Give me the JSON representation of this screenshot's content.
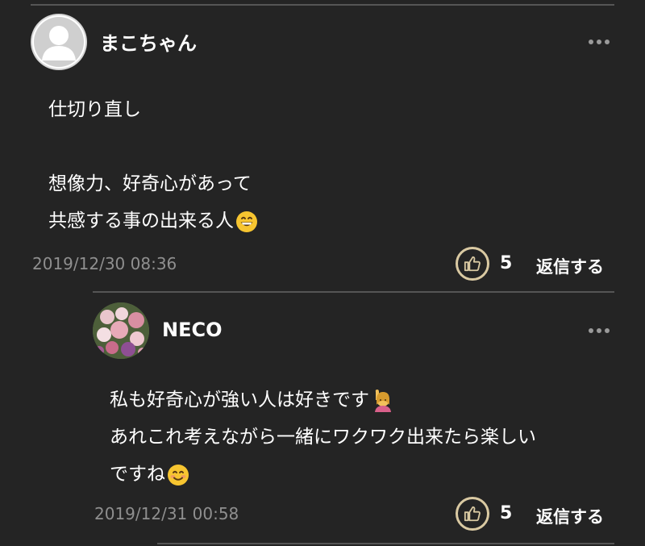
{
  "comments": [
    {
      "username": "まこちゃん",
      "avatar_icon": "default-user-avatar-icon",
      "lines": [
        "仕切り直し",
        "",
        "想像力、好奇心があって",
        "共感する事の出来る人"
      ],
      "trailing_emoji": "grinning-face-emoji",
      "timestamp": "2019/12/30 08:36",
      "like_count": "5",
      "reply_label": "返信する"
    },
    {
      "username": "NECO",
      "avatar_icon": "flower-bouquet-avatar",
      "lines": [
        "私も好奇心が強い人は好きです",
        "あれこれ考えながら一緒にワクワク出来たら楽しい",
        "ですね"
      ],
      "emojis": [
        "raising-hand-emoji",
        "smiling-face-emoji"
      ],
      "timestamp": "2019/12/31 00:58",
      "like_count": "5",
      "reply_label": "返信する"
    }
  ],
  "colors": {
    "background": "#242424",
    "text": "#ffffff",
    "timestamp": "#8f8f8f",
    "like_ring": "#d9c9a2",
    "divider": "#555555"
  }
}
